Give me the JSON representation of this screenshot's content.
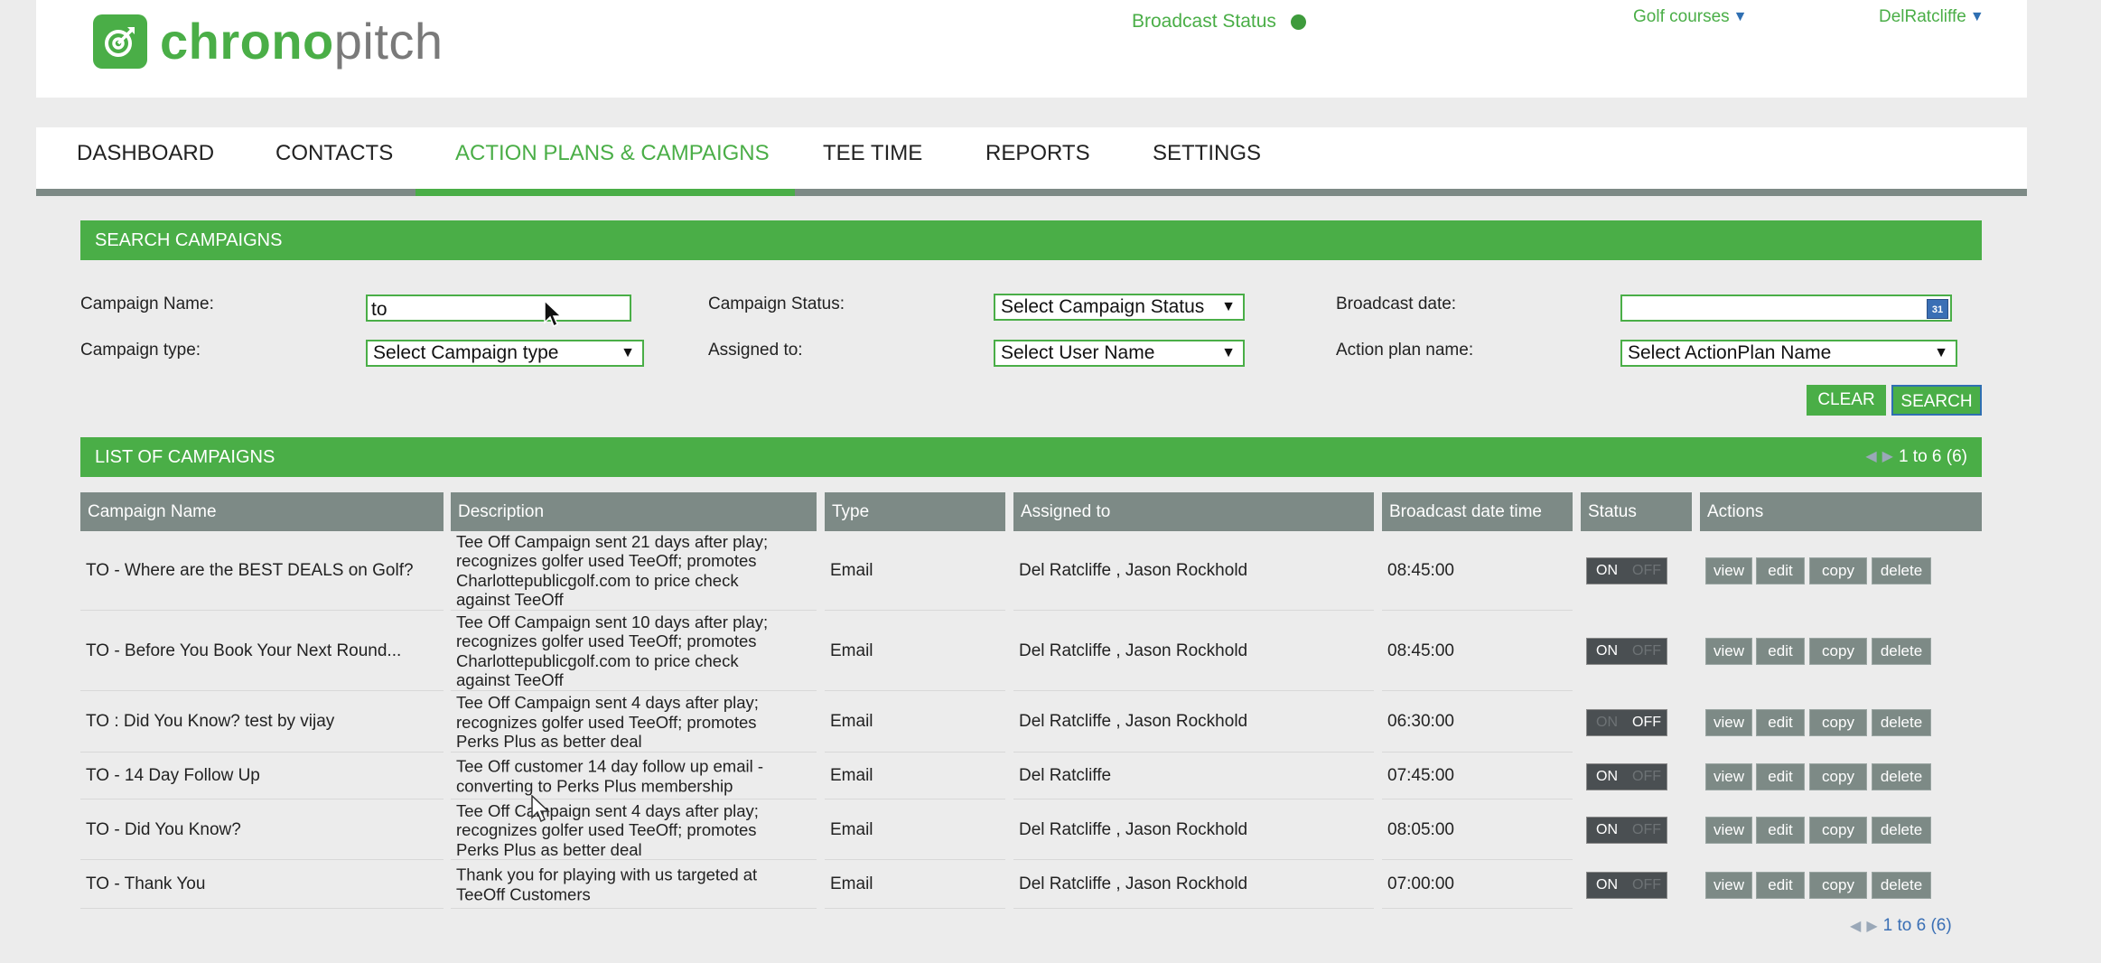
{
  "header": {
    "logo_primary": "chrono",
    "logo_secondary": "pitch",
    "broadcast_status": "Broadcast Status",
    "golf_courses": "Golf courses",
    "user": "DelRatcliffe",
    "caret": "▼"
  },
  "nav": {
    "items": [
      "DASHBOARD",
      "CONTACTS",
      "ACTION PLANS & CAMPAIGNS",
      "TEE TIME",
      "REPORTS",
      "SETTINGS"
    ],
    "active_index": 2
  },
  "search": {
    "title": "SEARCH CAMPAIGNS",
    "campaign_name_label": "Campaign Name:",
    "campaign_name_value": "to",
    "campaign_status_label": "Campaign Status:",
    "campaign_status_value": "Select Campaign Status",
    "broadcast_date_label": "Broadcast date:",
    "broadcast_date_value": "",
    "calendar_glyph": "31",
    "campaign_type_label": "Campaign type:",
    "campaign_type_value": "Select Campaign type",
    "assigned_to_label": "Assigned to:",
    "assigned_to_value": "Select User Name",
    "action_plan_label": "Action plan name:",
    "action_plan_value": "Select ActionPlan Name",
    "clear_label": "CLEAR",
    "search_label": "SEARCH",
    "arrow": "▼"
  },
  "list": {
    "title": "LIST OF CAMPAIGNS",
    "pager": "1 to 6 (6)",
    "pager_prev": "◀",
    "pager_next": "▶",
    "columns": [
      "Campaign Name",
      "Description",
      "Type",
      "Assigned to",
      "Broadcast date time",
      "Status",
      "Actions"
    ],
    "toggle_on": "ON",
    "toggle_off": "OFF",
    "actions": [
      "view",
      "edit",
      "copy",
      "delete"
    ],
    "rows": [
      {
        "name": "TO - Where are the BEST DEALS on Golf?",
        "description": [
          "Tee Off Campaign sent 21 days after play;",
          "recognizes golfer used TeeOff; promotes",
          "Charlottepublicgolf.com to price check",
          "against TeeOff"
        ],
        "type": "Email",
        "assigned": "Del Ratcliffe , Jason Rockhold",
        "time": "08:45:00",
        "status": "on"
      },
      {
        "name": "TO - Before You Book Your Next Round...",
        "description": [
          "Tee Off Campaign sent 10 days after play;",
          "recognizes golfer used TeeOff; promotes",
          "Charlottepublicgolf.com to price check",
          "against TeeOff"
        ],
        "type": "Email",
        "assigned": "Del Ratcliffe , Jason Rockhold",
        "time": "08:45:00",
        "status": "on"
      },
      {
        "name": "TO : Did You Know? test by vijay",
        "description": [
          "Tee Off Campaign sent 4 days after play;",
          "recognizes golfer used TeeOff; promotes",
          "Perks Plus as better deal"
        ],
        "type": "Email",
        "assigned": "Del Ratcliffe , Jason Rockhold",
        "time": "06:30:00",
        "status": "off"
      },
      {
        "name": "TO - 14 Day Follow Up",
        "description": [
          "Tee Off customer 14 day follow up email -",
          "converting to Perks Plus membership"
        ],
        "type": "Email",
        "assigned": "Del Ratcliffe",
        "time": "07:45:00",
        "status": "on"
      },
      {
        "name": "TO - Did You Know?",
        "description": [
          "Tee Off Campaign sent 4 days after play;",
          "recognizes golfer used TeeOff; promotes",
          "Perks Plus as better deal"
        ],
        "type": "Email",
        "assigned": "Del Ratcliffe , Jason Rockhold",
        "time": "08:05:00",
        "status": "on"
      },
      {
        "name": "TO - Thank You",
        "description": [
          "Thank you for playing with us targeted at",
          "TeeOff Customers"
        ],
        "type": "Email",
        "assigned": "Del Ratcliffe , Jason Rockhold",
        "time": "07:00:00",
        "status": "on"
      }
    ],
    "footer_pager": "1 to 6 (6)"
  },
  "colors": {
    "brand": "#4aae47",
    "header_grey": "#7d8a86",
    "toggle_dark": "#4a4f52"
  }
}
